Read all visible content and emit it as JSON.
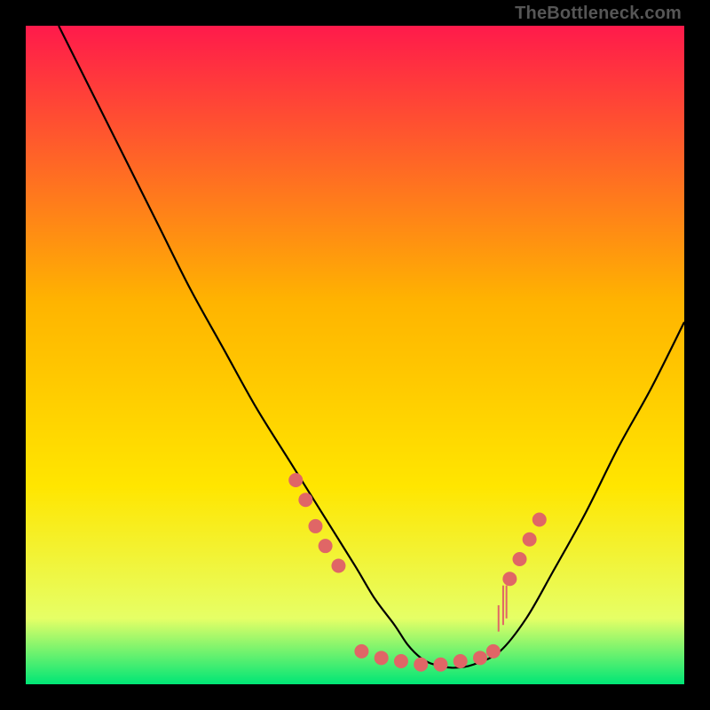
{
  "watermark": "TheBottleneck.com",
  "chart_data": {
    "type": "line",
    "title": "",
    "xlabel": "",
    "ylabel": "",
    "xlim": [
      0,
      100
    ],
    "ylim": [
      0,
      100
    ],
    "grid": false,
    "legend": false,
    "gradient_colors": {
      "top": "#ff1a4b",
      "mid_upper": "#ffb400",
      "mid_lower": "#ffe600",
      "near_bottom": "#e6ff66",
      "bottom": "#00e676"
    },
    "series": [
      {
        "name": "bottleneck-curve",
        "color": "#000000",
        "x": [
          5,
          10,
          15,
          20,
          25,
          30,
          35,
          40,
          45,
          50,
          53,
          56,
          58,
          60,
          62,
          65,
          68,
          72,
          76,
          80,
          85,
          90,
          95,
          100
        ],
        "y": [
          100,
          90,
          80,
          70,
          60,
          51,
          42,
          34,
          26,
          18,
          13,
          9,
          6,
          4,
          3,
          2.5,
          3,
          5,
          10,
          17,
          26,
          36,
          45,
          55
        ]
      }
    ],
    "markers": {
      "name": "highlight-dots",
      "color": "#e06666",
      "radius": 8,
      "points": [
        {
          "x": 41,
          "y": 31
        },
        {
          "x": 42.5,
          "y": 28
        },
        {
          "x": 44,
          "y": 24
        },
        {
          "x": 45.5,
          "y": 21
        },
        {
          "x": 47.5,
          "y": 18
        },
        {
          "x": 51,
          "y": 5
        },
        {
          "x": 54,
          "y": 4
        },
        {
          "x": 57,
          "y": 3.5
        },
        {
          "x": 60,
          "y": 3
        },
        {
          "x": 63,
          "y": 3
        },
        {
          "x": 66,
          "y": 3.5
        },
        {
          "x": 69,
          "y": 4
        },
        {
          "x": 71,
          "y": 5
        },
        {
          "x": 73.5,
          "y": 16
        },
        {
          "x": 75,
          "y": 19
        },
        {
          "x": 76.5,
          "y": 22
        },
        {
          "x": 78,
          "y": 25
        }
      ]
    },
    "small_ticks": {
      "color": "#e06666",
      "points": [
        {
          "x": 72.5,
          "y": 9,
          "h": 6
        },
        {
          "x": 73,
          "y": 10,
          "h": 5
        },
        {
          "x": 71.8,
          "y": 8,
          "h": 4
        }
      ]
    }
  }
}
